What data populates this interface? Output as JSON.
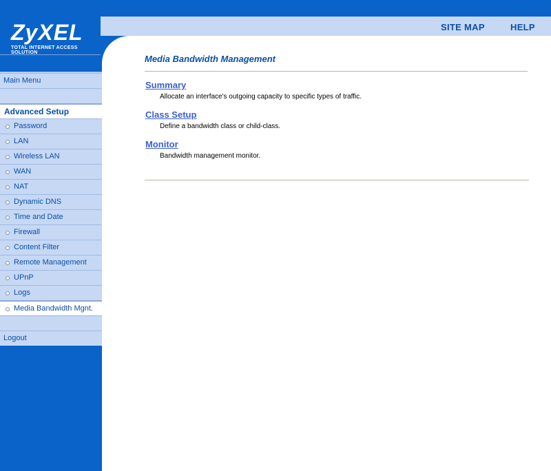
{
  "header": {
    "logo_word": "ZyXEL",
    "logo_tagline": "Total Internet Access Solution",
    "site_map": "SITE MAP",
    "help": "HELP"
  },
  "nav": {
    "main_menu": "Main Menu",
    "advanced_setup": "Advanced Setup",
    "items": [
      {
        "label": "Password"
      },
      {
        "label": "LAN"
      },
      {
        "label": "Wireless LAN"
      },
      {
        "label": "WAN"
      },
      {
        "label": "NAT"
      },
      {
        "label": "Dynamic DNS"
      },
      {
        "label": "Time and Date"
      },
      {
        "label": "Firewall"
      },
      {
        "label": "Content Filter"
      },
      {
        "label": "Remote Management"
      },
      {
        "label": "UPnP"
      },
      {
        "label": "Logs"
      },
      {
        "label": "Media Bandwidth Mgnt."
      }
    ],
    "logout": "Logout"
  },
  "main": {
    "title": "Media Bandwidth Management",
    "sections": [
      {
        "link": "Summary",
        "desc": "Allocate an interface's outgoing capacity to specific types of traffic."
      },
      {
        "link": "Class Setup",
        "desc": "Define a bandwidth class or child-class."
      },
      {
        "link": "Monitor",
        "desc": "Bandwidth management monitor."
      }
    ]
  }
}
